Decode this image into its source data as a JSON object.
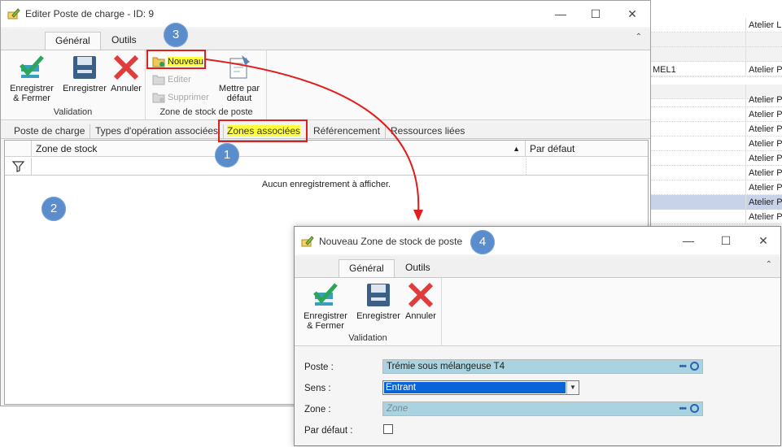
{
  "background_grid": {
    "rows": [
      {
        "c1": "",
        "c2": "Atelier L",
        "style": "plain"
      },
      {
        "c1": "",
        "c2": "",
        "style": "shade"
      },
      {
        "c1": "",
        "c2": "",
        "style": "shade"
      },
      {
        "c1": "",
        "c2": "",
        "style": "plain"
      },
      {
        "c1": "MEL1",
        "c2": "Atelier P",
        "style": "plain"
      },
      {
        "c1": "",
        "c2": "",
        "style": "shade"
      },
      {
        "c1": "",
        "c2": "Atelier P",
        "style": "plain"
      },
      {
        "c1": "",
        "c2": "Atelier P",
        "style": "plain"
      },
      {
        "c1": "",
        "c2": "Atelier P",
        "style": "plain"
      },
      {
        "c1": "",
        "c2": "Atelier P",
        "style": "plain"
      },
      {
        "c1": "",
        "c2": "Atelier P",
        "style": "plain"
      },
      {
        "c1": "",
        "c2": "Atelier P",
        "style": "plain"
      },
      {
        "c1": "",
        "c2": "Atelier P",
        "style": "plain"
      },
      {
        "c1": "",
        "c2": "Atelier P",
        "style": "sel"
      },
      {
        "c1": "",
        "c2": "Atelier P",
        "style": "plain"
      }
    ]
  },
  "main_window": {
    "title": "Editer Poste de charge - ID: 9",
    "controls": {
      "minimize": "—",
      "maximize": "☐",
      "close": "✕"
    },
    "ribbon_tabs": [
      "Général",
      "Outils"
    ],
    "collapse_icon": "⌃",
    "groups": {
      "validation": {
        "label": "Validation",
        "save_close": [
          "Enregistrer",
          "& Fermer"
        ],
        "save": "Enregistrer",
        "cancel": "Annuler"
      },
      "zone": {
        "label": "Zone de stock de poste",
        "new": "Nouveau",
        "edit": "Editer",
        "delete": "Supprimer",
        "set_default": [
          "Mettre par",
          "défaut"
        ]
      }
    },
    "page_tabs": [
      "Poste de charge",
      "Types d'opération associées",
      "Zones associées",
      "Référencement",
      "Ressources liées"
    ],
    "grid": {
      "columns": [
        "Zone de stock",
        "Par défaut"
      ],
      "sort_indicator": "▲",
      "empty_text": "Aucun enregistrement à afficher."
    }
  },
  "markers": [
    "1",
    "2",
    "3",
    "4"
  ],
  "dialog": {
    "title": "Nouveau Zone de stock de poste",
    "controls": {
      "minimize": "—",
      "maximize": "☐",
      "close": "✕"
    },
    "ribbon_tabs": [
      "Général",
      "Outils"
    ],
    "collapse_icon": "⌃",
    "validation": {
      "label": "Validation",
      "save_close": [
        "Enregistrer",
        "& Fermer"
      ],
      "save": "Enregistrer",
      "cancel": "Annuler"
    },
    "form": {
      "poste_label": "Poste :",
      "poste_value": "Trémie sous mélangeuse T4",
      "sens_label": "Sens :",
      "sens_value": "Entrant",
      "zone_label": "Zone :",
      "zone_placeholder": "Zone",
      "default_label": "Par défaut :",
      "default_checked": false,
      "ellipsis": "•••"
    }
  },
  "colors": {
    "highlight_border": "#e01e1e",
    "highlight_fill": "#ffff3a",
    "marker": "#5b8dcc",
    "field_blue": "#a9d3e0",
    "select_blue": "#0a64d8"
  }
}
